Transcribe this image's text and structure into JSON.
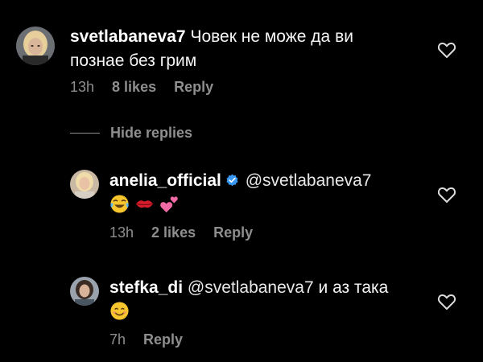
{
  "comments": [
    {
      "username": "svetlabaneva7",
      "text_line1": "Човек не може да ви",
      "text_line2": "познае без грим",
      "time": "13h",
      "likes": "8 likes",
      "reply": "Reply",
      "avatar_icon": "avatar-blonde-woman"
    }
  ],
  "hide_replies": "Hide replies",
  "replies": [
    {
      "username": "anelia_official",
      "verified": true,
      "mention": "@svetlabaneva7",
      "emojis": [
        "face-with-tears-of-joy",
        "kiss-mark",
        "two-hearts"
      ],
      "time": "13h",
      "likes": "2 likes",
      "reply": "Reply",
      "avatar_icon": "avatar-blonde-woman-small"
    },
    {
      "username": "stefka_di",
      "mention": "@svetlabaneva7",
      "text": "и аз така",
      "emojis": [
        "smiling-face-with-smiling-eyes"
      ],
      "time": "7h",
      "reply": "Reply",
      "avatar_icon": "avatar-dark-hair-woman"
    }
  ],
  "colors": {
    "background": "#000000",
    "text": "#ffffff",
    "secondary": "#8e8e8e",
    "verified": "#3897f0"
  }
}
